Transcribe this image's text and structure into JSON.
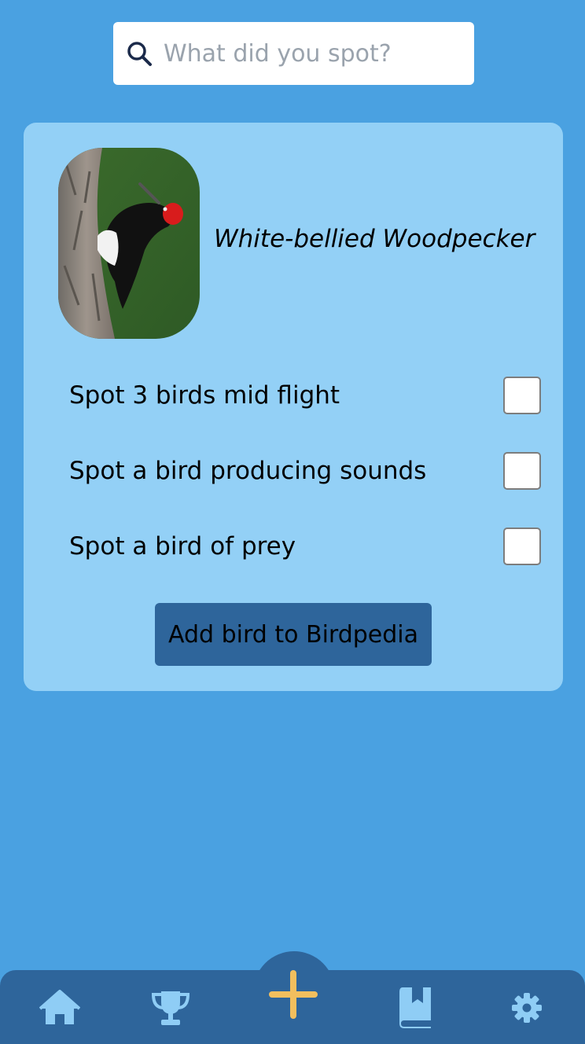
{
  "search": {
    "placeholder": "What did you spot?",
    "icon": "search-icon"
  },
  "bird": {
    "name": "White-bellied Woodpecker",
    "photo_icon": "woodpecker-photo"
  },
  "tasks": [
    {
      "label": "Spot 3 birds mid flight",
      "checked": false
    },
    {
      "label": "Spot a bird producing sounds",
      "checked": false
    },
    {
      "label": "Spot a bird of prey",
      "checked": false
    }
  ],
  "add_button": {
    "label": "Add bird to Birdpedia"
  },
  "nav": {
    "items": [
      {
        "icon": "home-icon"
      },
      {
        "icon": "trophy-icon"
      },
      {
        "icon": "plus-icon"
      },
      {
        "icon": "book-icon"
      },
      {
        "icon": "gear-icon"
      }
    ]
  },
  "colors": {
    "background": "#4aa1e1",
    "card": "#93d0f6",
    "nav": "#2e659b",
    "accent_plus": "#f2bf5e",
    "nav_icons": "#8fcdf5"
  }
}
